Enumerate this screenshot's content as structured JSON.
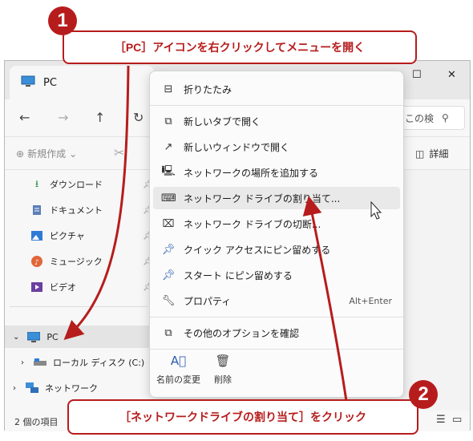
{
  "window": {
    "tab_title": "PC",
    "maximize": "☐",
    "close": "✕"
  },
  "navbar": {
    "search_placeholder": "この検"
  },
  "toolbar": {
    "new_label": "新規作成",
    "detail_label": "詳細"
  },
  "sidebar": {
    "items": [
      {
        "label": "ダウンロード",
        "icon": "download-icon"
      },
      {
        "label": "ドキュメント",
        "icon": "document-icon"
      },
      {
        "label": "ピクチャ",
        "icon": "picture-icon"
      },
      {
        "label": "ミュージック",
        "icon": "music-icon"
      },
      {
        "label": "ビデオ",
        "icon": "video-icon"
      }
    ],
    "pc_label": "PC",
    "local_disk_label": "ローカル ディスク (C:)",
    "network_label": "ネットワーク"
  },
  "status": {
    "count": "2 個の項目"
  },
  "menu": {
    "items": [
      {
        "label": "折りたたみ",
        "icon": "collapse-icon"
      },
      {
        "label": "新しいタブで開く",
        "icon": "new-tab-icon"
      },
      {
        "label": "新しいウィンドウで開く",
        "icon": "new-window-icon"
      },
      {
        "label": "ネットワークの場所を追加する",
        "icon": "network-location-icon"
      },
      {
        "label": "ネットワーク ドライブの割り当て...",
        "icon": "map-drive-icon"
      },
      {
        "label": "ネットワーク ドライブの切断...",
        "icon": "disconnect-drive-icon"
      },
      {
        "label": "クイック アクセスにピン留めする",
        "icon": "pin-icon"
      },
      {
        "label": "スタート にピン留めする",
        "icon": "pin-start-icon"
      },
      {
        "label": "プロパティ",
        "icon": "wrench-icon",
        "shortcut": "Alt+Enter"
      },
      {
        "label": "その他のオプションを確認",
        "icon": "more-options-icon"
      }
    ],
    "rename_label": "名前の変更",
    "delete_label": "削除"
  },
  "callouts": {
    "step1_badge": "1",
    "step1_text": "［PC］アイコンを右クリックしてメニューを開く",
    "step2_badge": "2",
    "step2_text": "［ネットワークドライブの割り当て］をクリック"
  },
  "colors": {
    "accent_red": "#b71c1c",
    "icon_blue": "#2a5db0"
  }
}
